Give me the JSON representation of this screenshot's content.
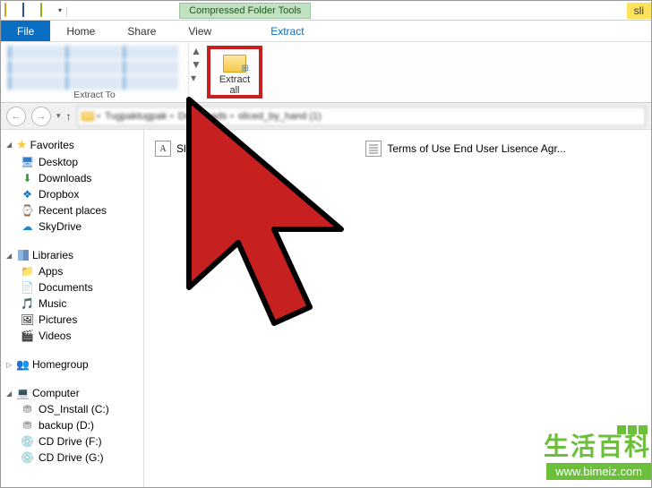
{
  "titlebar": {
    "contextual_tab": "Compressed Folder Tools",
    "right_text": "sli"
  },
  "tabs": {
    "file": "File",
    "home": "Home",
    "share": "Share",
    "view": "View",
    "extract": "Extract"
  },
  "ribbon": {
    "extract_to_label": "Extract To",
    "extract_all_label": "Extract\nall"
  },
  "breadcrumb": {
    "segments": [
      "Tugpaktugpak",
      "Downloads",
      "sliced_by_hand (1)"
    ]
  },
  "sidebar": {
    "favorites": {
      "label": "Favorites",
      "items": [
        {
          "label": "Desktop",
          "icon": "desktop"
        },
        {
          "label": "Downloads",
          "icon": "download"
        },
        {
          "label": "Dropbox",
          "icon": "dropbox"
        },
        {
          "label": "Recent places",
          "icon": "recent"
        },
        {
          "label": "SkyDrive",
          "icon": "skydrive"
        }
      ]
    },
    "libraries": {
      "label": "Libraries",
      "items": [
        {
          "label": "Apps",
          "icon": "folder"
        },
        {
          "label": "Documents",
          "icon": "folder"
        },
        {
          "label": "Music",
          "icon": "folder"
        },
        {
          "label": "Pictures",
          "icon": "folder"
        },
        {
          "label": "Videos",
          "icon": "folder"
        }
      ]
    },
    "homegroup": {
      "label": "Homegroup"
    },
    "computer": {
      "label": "Computer",
      "items": [
        {
          "label": "OS_Install (C:)",
          "icon": "drive"
        },
        {
          "label": "backup (D:)",
          "icon": "drive"
        },
        {
          "label": "CD Drive (F:)",
          "icon": "disc"
        },
        {
          "label": "CD Drive (G:)",
          "icon": "disc"
        }
      ]
    }
  },
  "files": [
    {
      "name": "Sliced by Ha",
      "icon": "font"
    },
    {
      "name": "Terms of Use End User Lisence Agr...",
      "icon": "text"
    }
  ],
  "watermark": {
    "cn": "生活百科",
    "url": "www.bimeiz.com"
  }
}
